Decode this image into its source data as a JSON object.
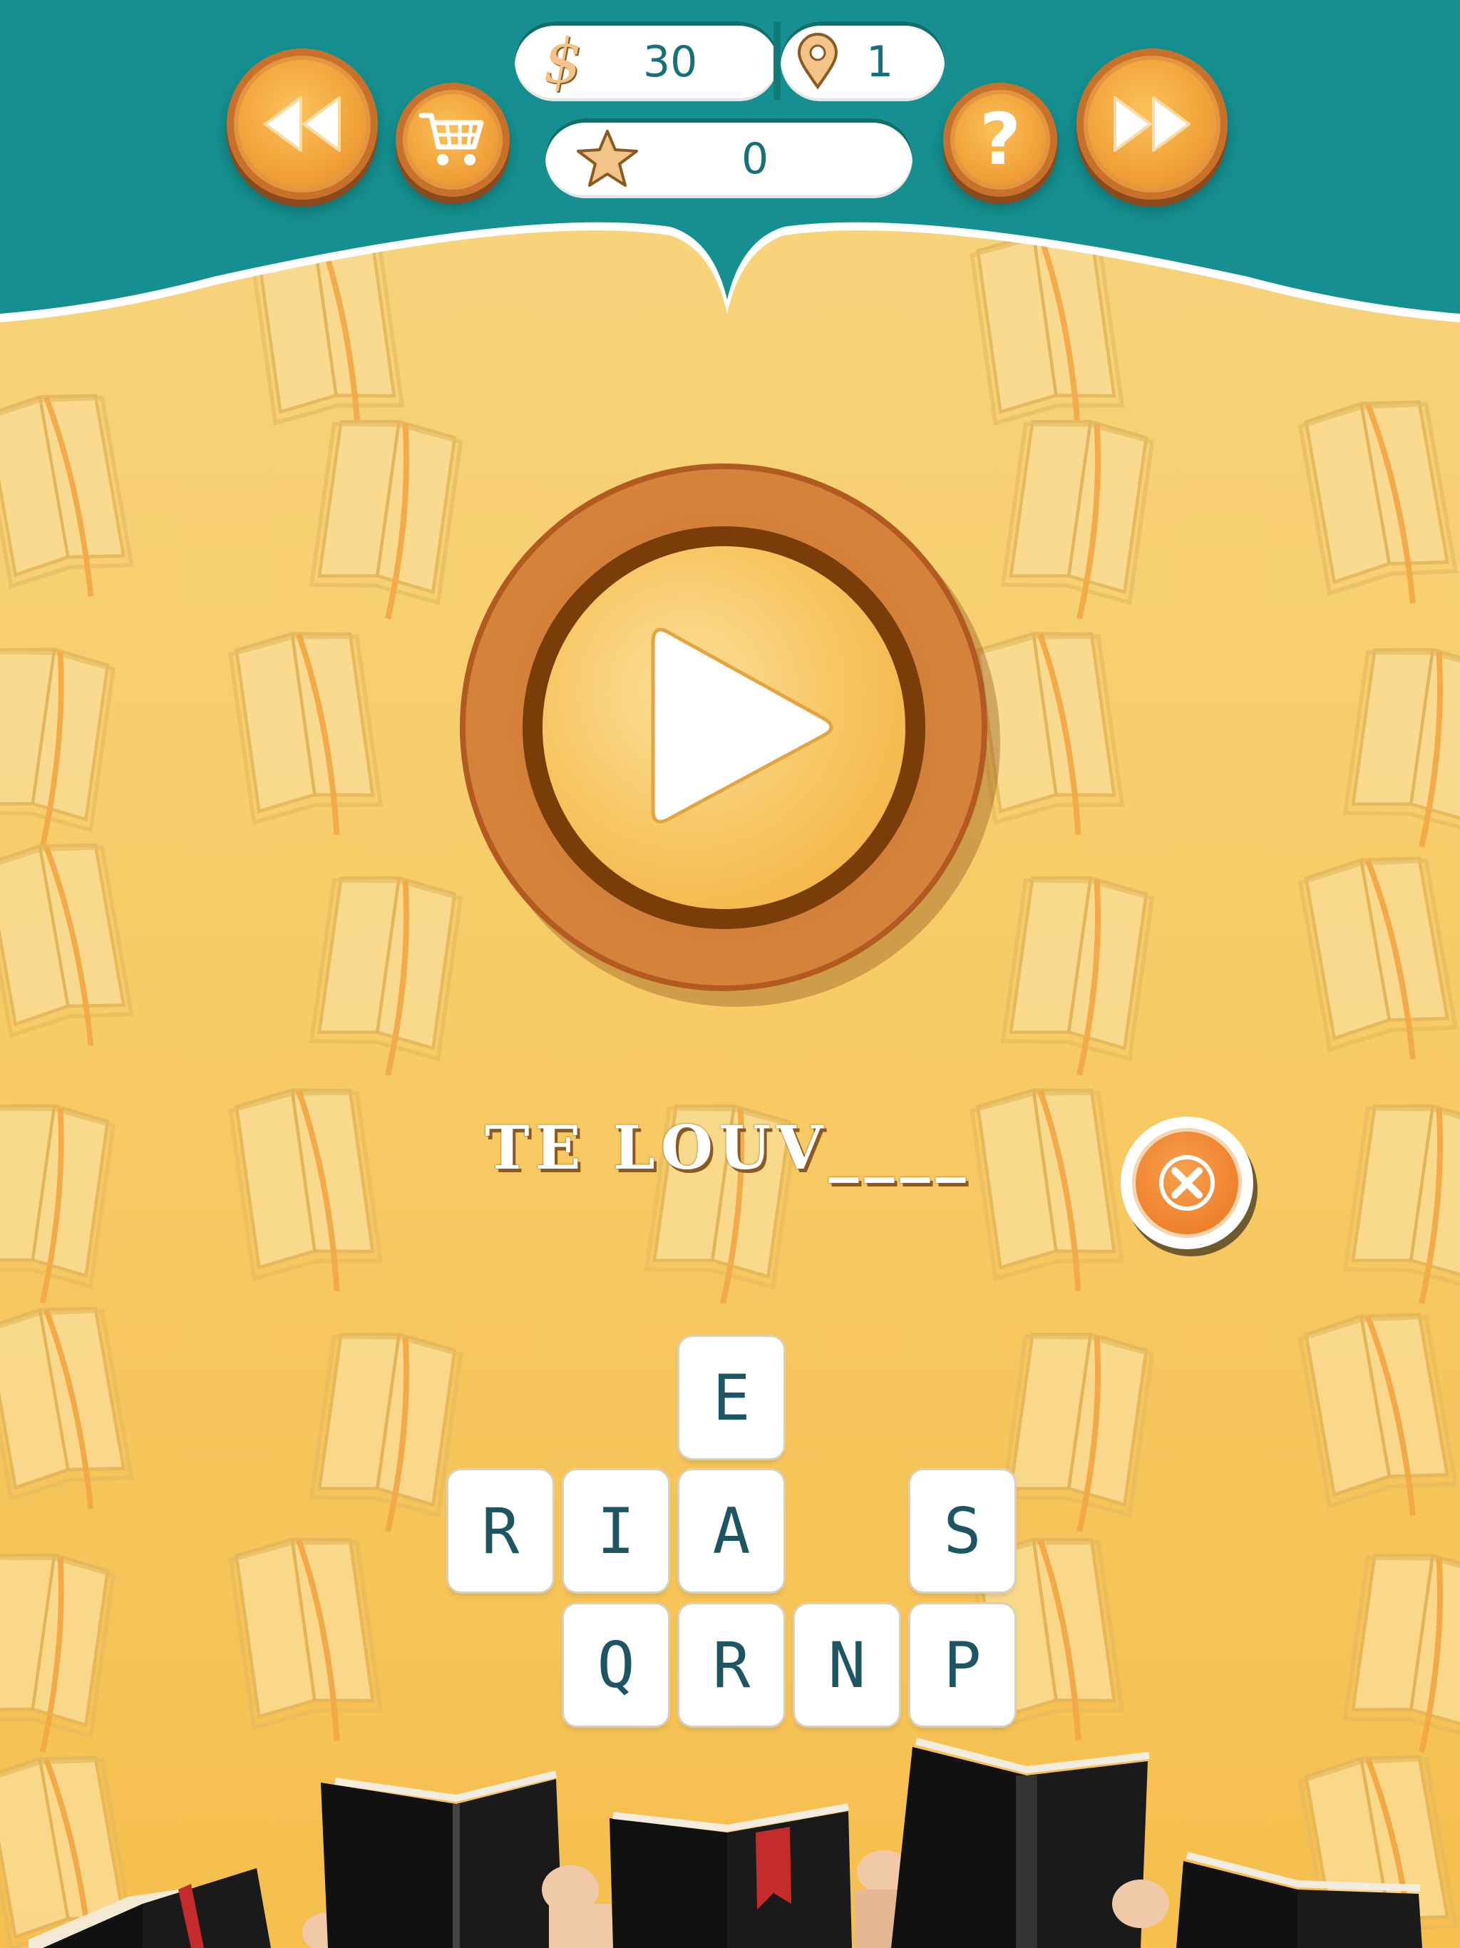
{
  "header": {
    "back_button_icon": "double-left-arrow-icon",
    "shop_button_icon": "cart-icon",
    "help_button_icon": "question-icon",
    "forward_button_icon": "double-right-arrow-icon",
    "coins": {
      "icon": "dollar-icon",
      "value": "30"
    },
    "level": {
      "icon": "location-pin-icon",
      "value": "1"
    },
    "stars": {
      "icon": "star-icon",
      "value": "0"
    }
  },
  "play_button_icon": "play-icon",
  "answer": {
    "text": "TE LOUV____",
    "clear_icon": "close-icon"
  },
  "letters": {
    "row1": [
      "E"
    ],
    "row2": [
      "R",
      "I",
      "A",
      "S"
    ],
    "row3": [
      "Q",
      "R",
      "N",
      "P"
    ]
  },
  "colors": {
    "header_teal": "#158f8f",
    "background_yellow": "#f7cd6a",
    "button_orange": "#f2a23a",
    "tile_text": "#1d5563"
  }
}
